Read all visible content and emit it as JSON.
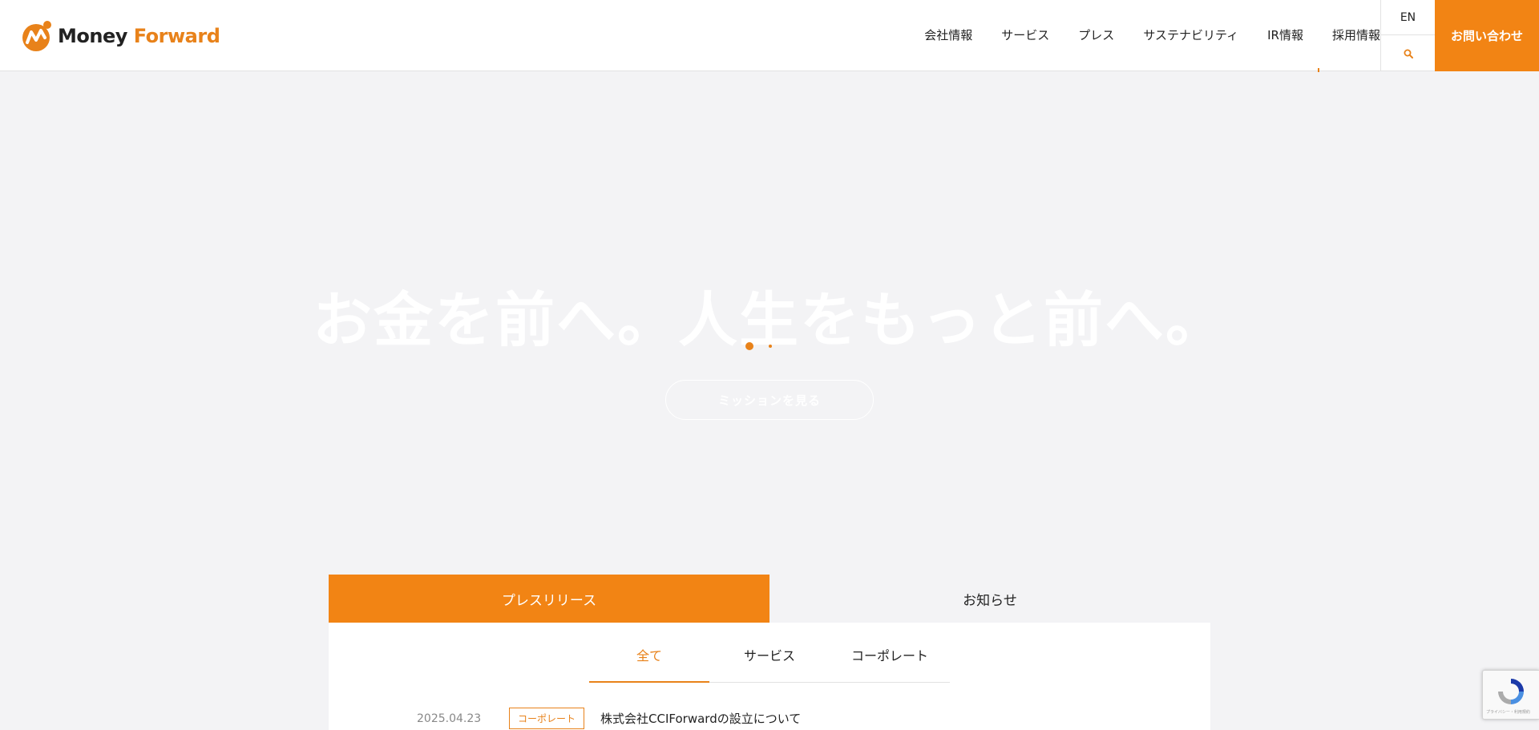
{
  "logo": {
    "word1": "Money",
    "word2": "Forward"
  },
  "nav": {
    "items": [
      "会社情報",
      "サービス",
      "プレス",
      "サステナビリティ",
      "IR情報",
      "採用情報"
    ]
  },
  "lang": {
    "label": "EN"
  },
  "contact": {
    "label": "お問い合わせ"
  },
  "hero": {
    "copy": "お金を前へ。人生をもっと前へ。",
    "button_label": "ミッションを見る"
  },
  "news": {
    "tabs": [
      "プレスリリース",
      "お知らせ"
    ],
    "sub_tabs": [
      "全て",
      "サービス",
      "コーポレート"
    ],
    "rows": [
      {
        "date": "2025.04.23",
        "category": "コーポレート",
        "title": "株式会社CCIForwardの設立について"
      }
    ]
  },
  "recaptcha": {
    "text": "プライバシー・利用規約"
  },
  "colors": {
    "accent": "#f28414",
    "hero_bg": "#f3f3f5"
  }
}
